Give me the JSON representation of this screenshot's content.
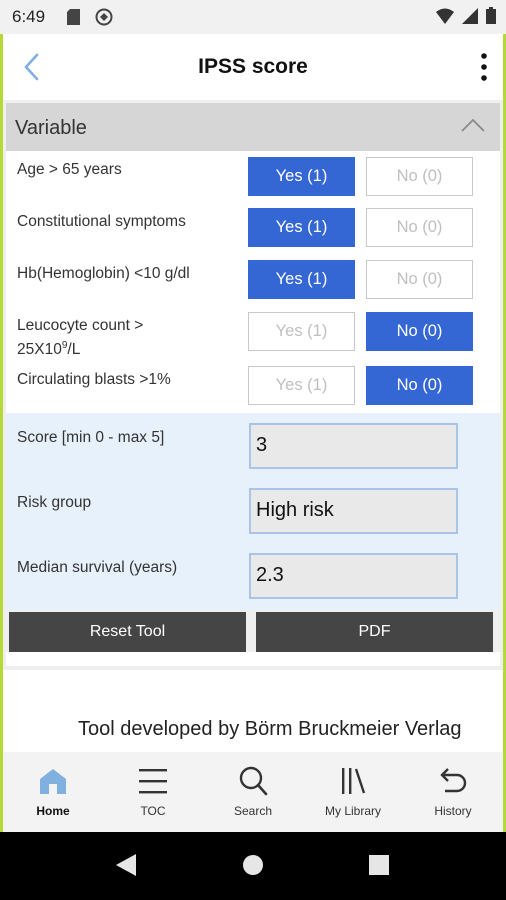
{
  "status_bar": {
    "time": "6:49"
  },
  "header": {
    "title": "IPSS score"
  },
  "section": {
    "title": "Variable"
  },
  "variables": [
    {
      "label": "Age > 65 years",
      "yes": "Yes (1)",
      "no": "No (0)",
      "selected": "yes"
    },
    {
      "label": "Constitutional symptoms",
      "yes": "Yes (1)",
      "no": "No (0)",
      "selected": "yes"
    },
    {
      "label": "Hb(Hemoglobin) <10 g/dl",
      "yes": "Yes (1)",
      "no": "No (0)",
      "selected": "yes"
    },
    {
      "label_main": "Leucocyte count >",
      "label_line2": "25X10",
      "label_sup": "9",
      "label_tail": "/L",
      "yes": "Yes (1)",
      "no": "No (0)",
      "selected": "no"
    },
    {
      "label": "Circulating blasts >1%",
      "yes": "Yes (1)",
      "no": "No (0)",
      "selected": "no"
    }
  ],
  "results": {
    "score_label": "Score [min 0 - max 5]",
    "score_value": "3",
    "risk_label": "Risk group",
    "risk_value": "High risk",
    "survival_label": "Median survival (years)",
    "survival_value": "2.3"
  },
  "actions": {
    "reset_label": "Reset Tool",
    "pdf_label": "PDF"
  },
  "footer": {
    "credit": "Tool developed by Börm Bruckmeier Verlag"
  },
  "nav": {
    "items": [
      {
        "label": "Home",
        "icon": "home-icon",
        "active": true
      },
      {
        "label": "TOC",
        "icon": "menu-icon"
      },
      {
        "label": "Search",
        "icon": "search-icon"
      },
      {
        "label": "My Library",
        "icon": "library-icon"
      },
      {
        "label": "History",
        "icon": "history-icon"
      }
    ]
  },
  "colors": {
    "accent": "#3567d4",
    "edge_accent": "#b6d93a",
    "button_dark": "#454545",
    "result_bg": "#e6f1fb"
  }
}
